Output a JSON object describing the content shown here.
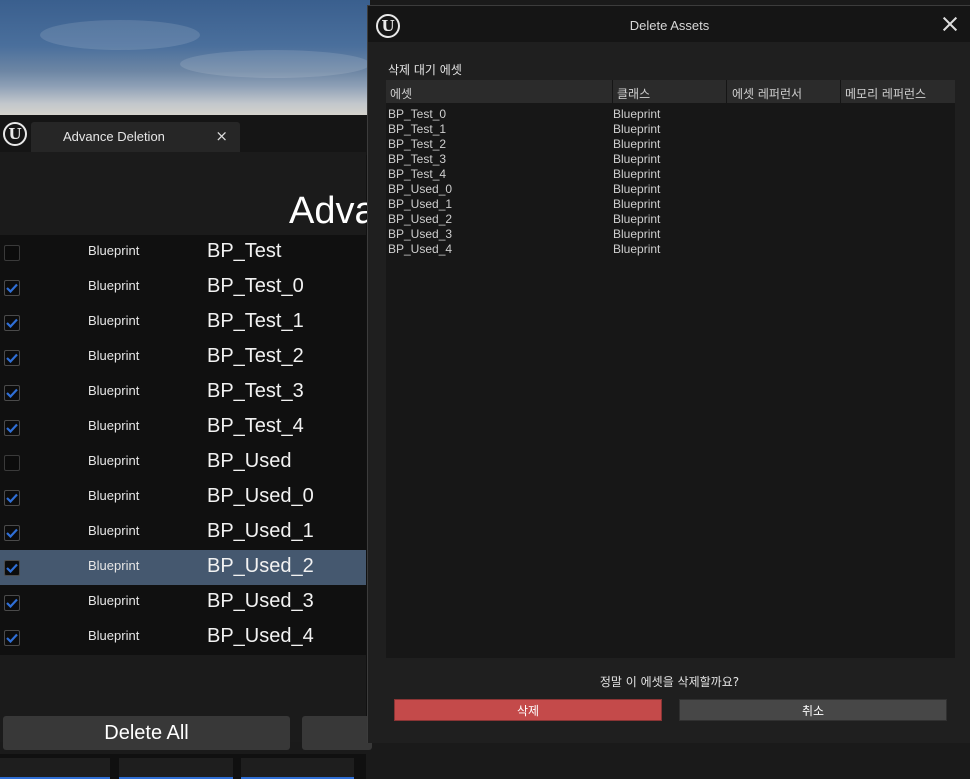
{
  "tool_window": {
    "tab_label": "Advance Deletion",
    "tab_close": "×",
    "title": "Adva",
    "rows": [
      {
        "class": "Blueprint",
        "name": "BP_Test",
        "checked": false,
        "selected": false
      },
      {
        "class": "Blueprint",
        "name": "BP_Test_0",
        "checked": true,
        "selected": false
      },
      {
        "class": "Blueprint",
        "name": "BP_Test_1",
        "checked": true,
        "selected": false
      },
      {
        "class": "Blueprint",
        "name": "BP_Test_2",
        "checked": true,
        "selected": false
      },
      {
        "class": "Blueprint",
        "name": "BP_Test_3",
        "checked": true,
        "selected": false
      },
      {
        "class": "Blueprint",
        "name": "BP_Test_4",
        "checked": true,
        "selected": false
      },
      {
        "class": "Blueprint",
        "name": "BP_Used",
        "checked": false,
        "selected": false
      },
      {
        "class": "Blueprint",
        "name": "BP_Used_0",
        "checked": true,
        "selected": false
      },
      {
        "class": "Blueprint",
        "name": "BP_Used_1",
        "checked": true,
        "selected": false
      },
      {
        "class": "Blueprint",
        "name": "BP_Used_2",
        "checked": true,
        "selected": true
      },
      {
        "class": "Blueprint",
        "name": "BP_Used_3",
        "checked": true,
        "selected": false
      },
      {
        "class": "Blueprint",
        "name": "BP_Used_4",
        "checked": true,
        "selected": false
      }
    ],
    "delete_all_label": "Delete All"
  },
  "dialog": {
    "title": "Delete Assets",
    "section_label": "삭제 대기 에셋",
    "columns": [
      "에셋",
      "클래스",
      "에셋 레퍼런서",
      "메모리 레퍼런스"
    ],
    "rows": [
      {
        "asset": "BP_Test_0",
        "class": "Blueprint"
      },
      {
        "asset": "BP_Test_1",
        "class": "Blueprint"
      },
      {
        "asset": "BP_Test_2",
        "class": "Blueprint"
      },
      {
        "asset": "BP_Test_3",
        "class": "Blueprint"
      },
      {
        "asset": "BP_Test_4",
        "class": "Blueprint"
      },
      {
        "asset": "BP_Used_0",
        "class": "Blueprint"
      },
      {
        "asset": "BP_Used_1",
        "class": "Blueprint"
      },
      {
        "asset": "BP_Used_2",
        "class": "Blueprint"
      },
      {
        "asset": "BP_Used_3",
        "class": "Blueprint"
      },
      {
        "asset": "BP_Used_4",
        "class": "Blueprint"
      }
    ],
    "confirm_question": "정말 이 에셋을 삭제할까요?",
    "confirm_label": "삭제",
    "cancel_label": "취소"
  },
  "colors": {
    "accent_blue": "#2f6fd6",
    "selected_row": "#45586f",
    "delete_red": "#c44a4a"
  }
}
